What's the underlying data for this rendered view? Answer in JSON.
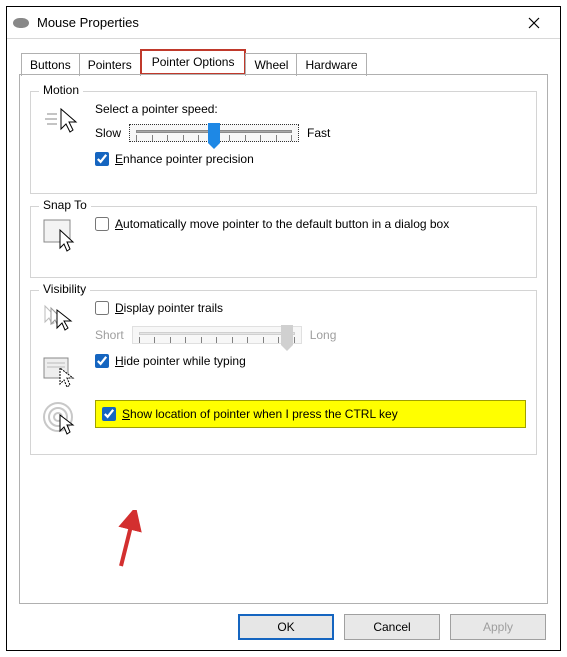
{
  "window": {
    "title": "Mouse Properties"
  },
  "tabs": {
    "buttons": "Buttons",
    "pointers": "Pointers",
    "pointer_options": "Pointer Options",
    "wheel": "Wheel",
    "hardware": "Hardware",
    "active": "pointer_options"
  },
  "motion": {
    "legend": "Motion",
    "select_speed": "Select a pointer speed:",
    "slow": "Slow",
    "fast": "Fast",
    "enhance": "Enhance pointer precision",
    "enhance_checked": true,
    "speed_value": 6
  },
  "snap_to": {
    "legend": "Snap To",
    "auto_move": "Automatically move pointer to the default button in a dialog box",
    "auto_move_checked": false
  },
  "visibility": {
    "legend": "Visibility",
    "display_trails": "Display pointer trails",
    "display_trails_checked": false,
    "short": "Short",
    "long": "Long",
    "hide_typing": "Hide pointer while typing",
    "hide_typing_checked": true,
    "show_ctrl": "Show location of pointer when I press the CTRL key",
    "show_ctrl_checked": true
  },
  "buttons": {
    "ok": "OK",
    "cancel": "Cancel",
    "apply": "Apply"
  }
}
